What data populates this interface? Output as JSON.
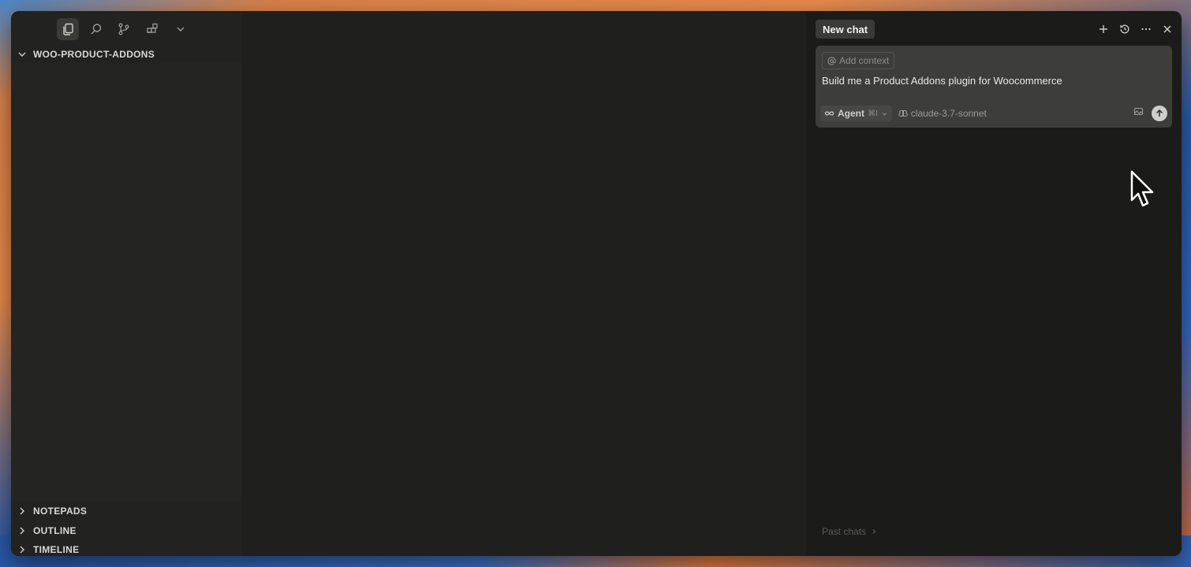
{
  "explorer": {
    "project_name": "WOO-PRODUCT-ADDONS",
    "sections": [
      "NOTEPADS",
      "OUTLINE",
      "TIMELINE"
    ]
  },
  "chat": {
    "tab_label": "New chat",
    "add_context_label": "Add context",
    "prompt": "Build me a Product Addons plugin for Woocommerce",
    "mode_label": "Agent",
    "mode_shortcut": "⌘I",
    "model_label": "claude-3.7-sonnet",
    "past_chats_label": "Past chats"
  },
  "icons": {
    "toolbar": [
      "files-icon",
      "search-icon",
      "source-control-icon",
      "extensions-icon",
      "chevron-down-icon"
    ],
    "chat_actions": [
      "plus-icon",
      "history-icon",
      "more-icon",
      "close-icon"
    ]
  },
  "colors": {
    "window_bg": "#1d1d1b",
    "sidebar_bg": "#222220",
    "composer_bg": "#3d3d3a",
    "tab_bg": "#3a3a37"
  }
}
